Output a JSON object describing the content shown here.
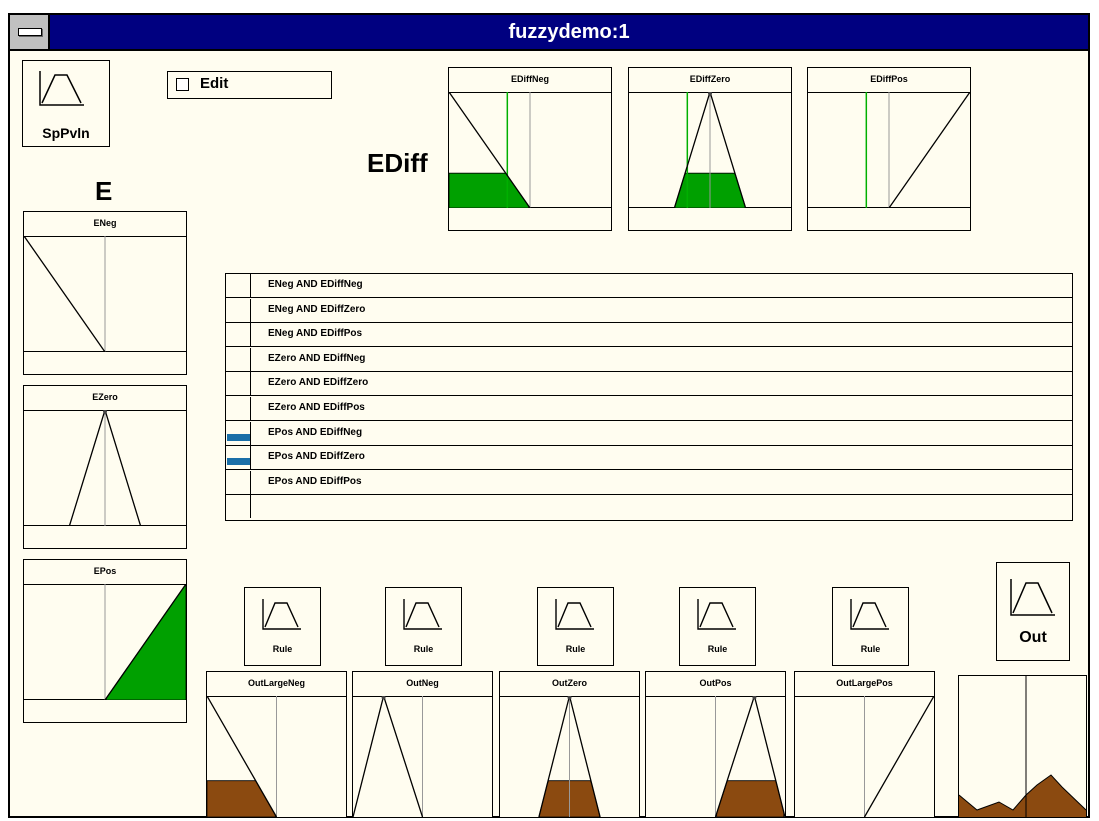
{
  "window": {
    "title": "fuzzydemo:1"
  },
  "toolbar": {
    "sp_button_label": "SpPvln",
    "edit_checkbox_label": "Edit",
    "edit_checked": false
  },
  "labels": {
    "ediff": "EDiff",
    "e": "E"
  },
  "ediff_sets": [
    {
      "name": "EDiffNeg",
      "shape": "neg",
      "fire": 0.3
    },
    {
      "name": "EDiffZero",
      "shape": "zero",
      "fire": 0.3
    },
    {
      "name": "EDiffPos",
      "shape": "pos",
      "fire": 0.0
    }
  ],
  "e_sets": [
    {
      "name": "ENeg",
      "shape": "neg",
      "fire": 0.0
    },
    {
      "name": "EZero",
      "shape": "zero",
      "fire": 0.0
    },
    {
      "name": "EPos",
      "shape": "pos",
      "fire": 1.0
    }
  ],
  "rules": [
    {
      "text": "ENeg AND EDiffNeg",
      "strength": 0
    },
    {
      "text": "ENeg AND EDiffZero",
      "strength": 0
    },
    {
      "text": "ENeg AND EDiffPos",
      "strength": 0
    },
    {
      "text": "EZero AND EDiffNeg",
      "strength": 0
    },
    {
      "text": "EZero AND EDiffZero",
      "strength": 0
    },
    {
      "text": "EZero AND EDiffPos",
      "strength": 0
    },
    {
      "text": "EPos AND EDiffNeg",
      "strength": 0.3
    },
    {
      "text": "EPos AND EDiffZero",
      "strength": 0.3
    },
    {
      "text": "EPos AND EDiffPos",
      "strength": 0
    },
    {
      "text": "",
      "strength": 0
    }
  ],
  "rule_buttons": [
    "Rule",
    "Rule",
    "Rule",
    "Rule",
    "Rule"
  ],
  "out_sets": [
    {
      "name": "OutLargeNeg",
      "shape": "neg",
      "fire": 0.3
    },
    {
      "name": "OutNeg",
      "shape": "negtri",
      "fire": 0.0
    },
    {
      "name": "OutZero",
      "shape": "zero",
      "fire": 0.3
    },
    {
      "name": "OutPos",
      "shape": "postri",
      "fire": 0.3
    },
    {
      "name": "OutLargePos",
      "shape": "pos",
      "fire": 0.0
    }
  ],
  "out_button_label": "Out",
  "colors": {
    "titlebar": "#000080",
    "input_fill": "#00a000",
    "output_fill": "#8b4a10",
    "rule_strength": "#1a6fa8",
    "panel_bg": "#fffdf0",
    "axis_line": "#999999",
    "input_marker": "#00b000"
  }
}
